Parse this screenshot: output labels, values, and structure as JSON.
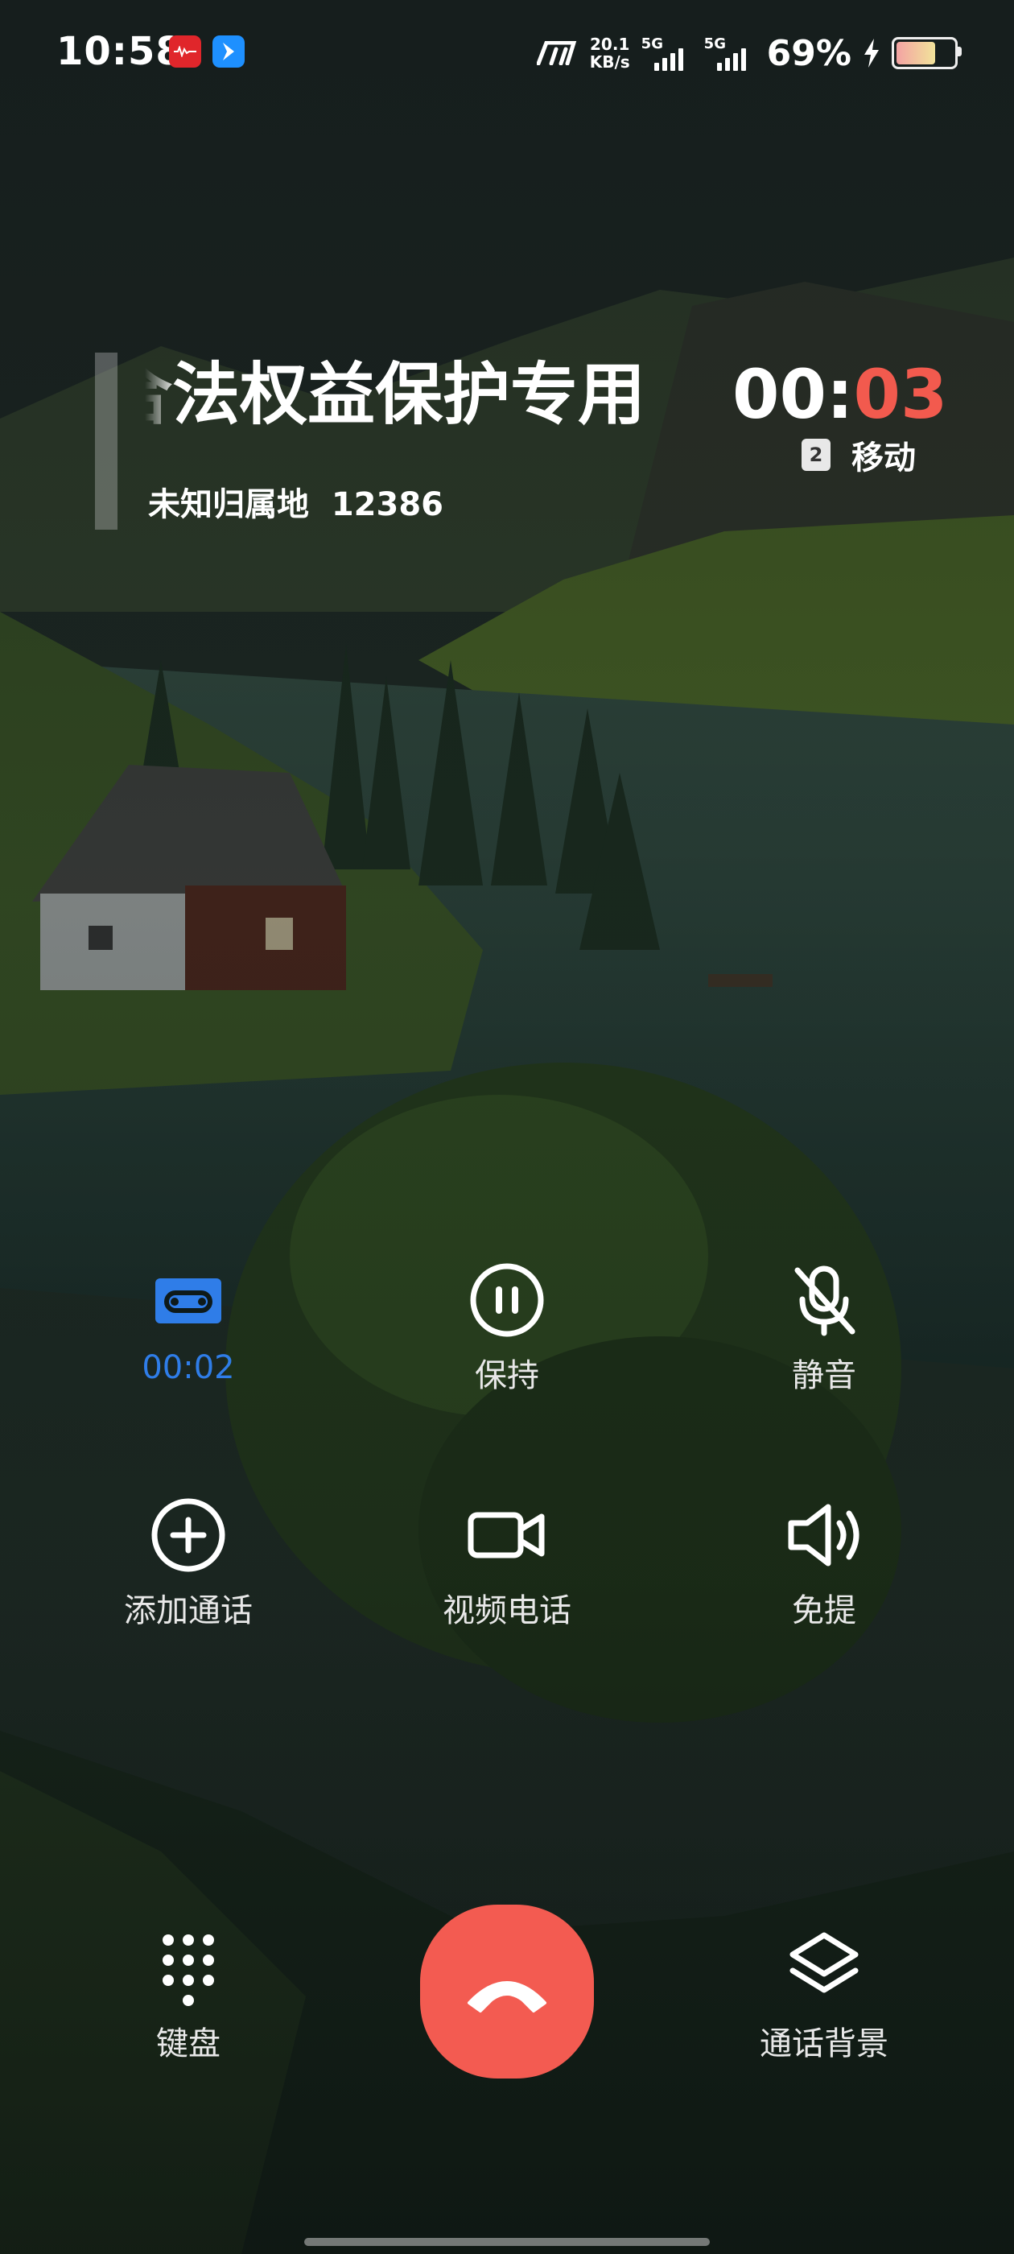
{
  "status_bar": {
    "time": "10:58",
    "network_speed_value": "20.1",
    "network_speed_unit": "KB/s",
    "sim1_type": "5G",
    "sim2_type": "5G",
    "battery_percent": "69%",
    "battery_level": 0.69
  },
  "caller": {
    "name": "合法权益保护专用",
    "location_number": "未知归属地  12386",
    "timer_prefix": "00:",
    "timer_seconds": "03",
    "sim_slot": "2",
    "carrier": "移动"
  },
  "controls": {
    "record_label": "00:02",
    "hold_label": "保持",
    "mute_label": "静音",
    "add_call_label": "添加通话",
    "video_call_label": "视频电话",
    "speaker_label": "免提",
    "keypad_label": "键盘",
    "call_background_label": "通话背景"
  },
  "colors": {
    "accent_blue": "#2f7de8",
    "end_call_red": "#f35b51",
    "timer_red": "#f25a4e"
  }
}
